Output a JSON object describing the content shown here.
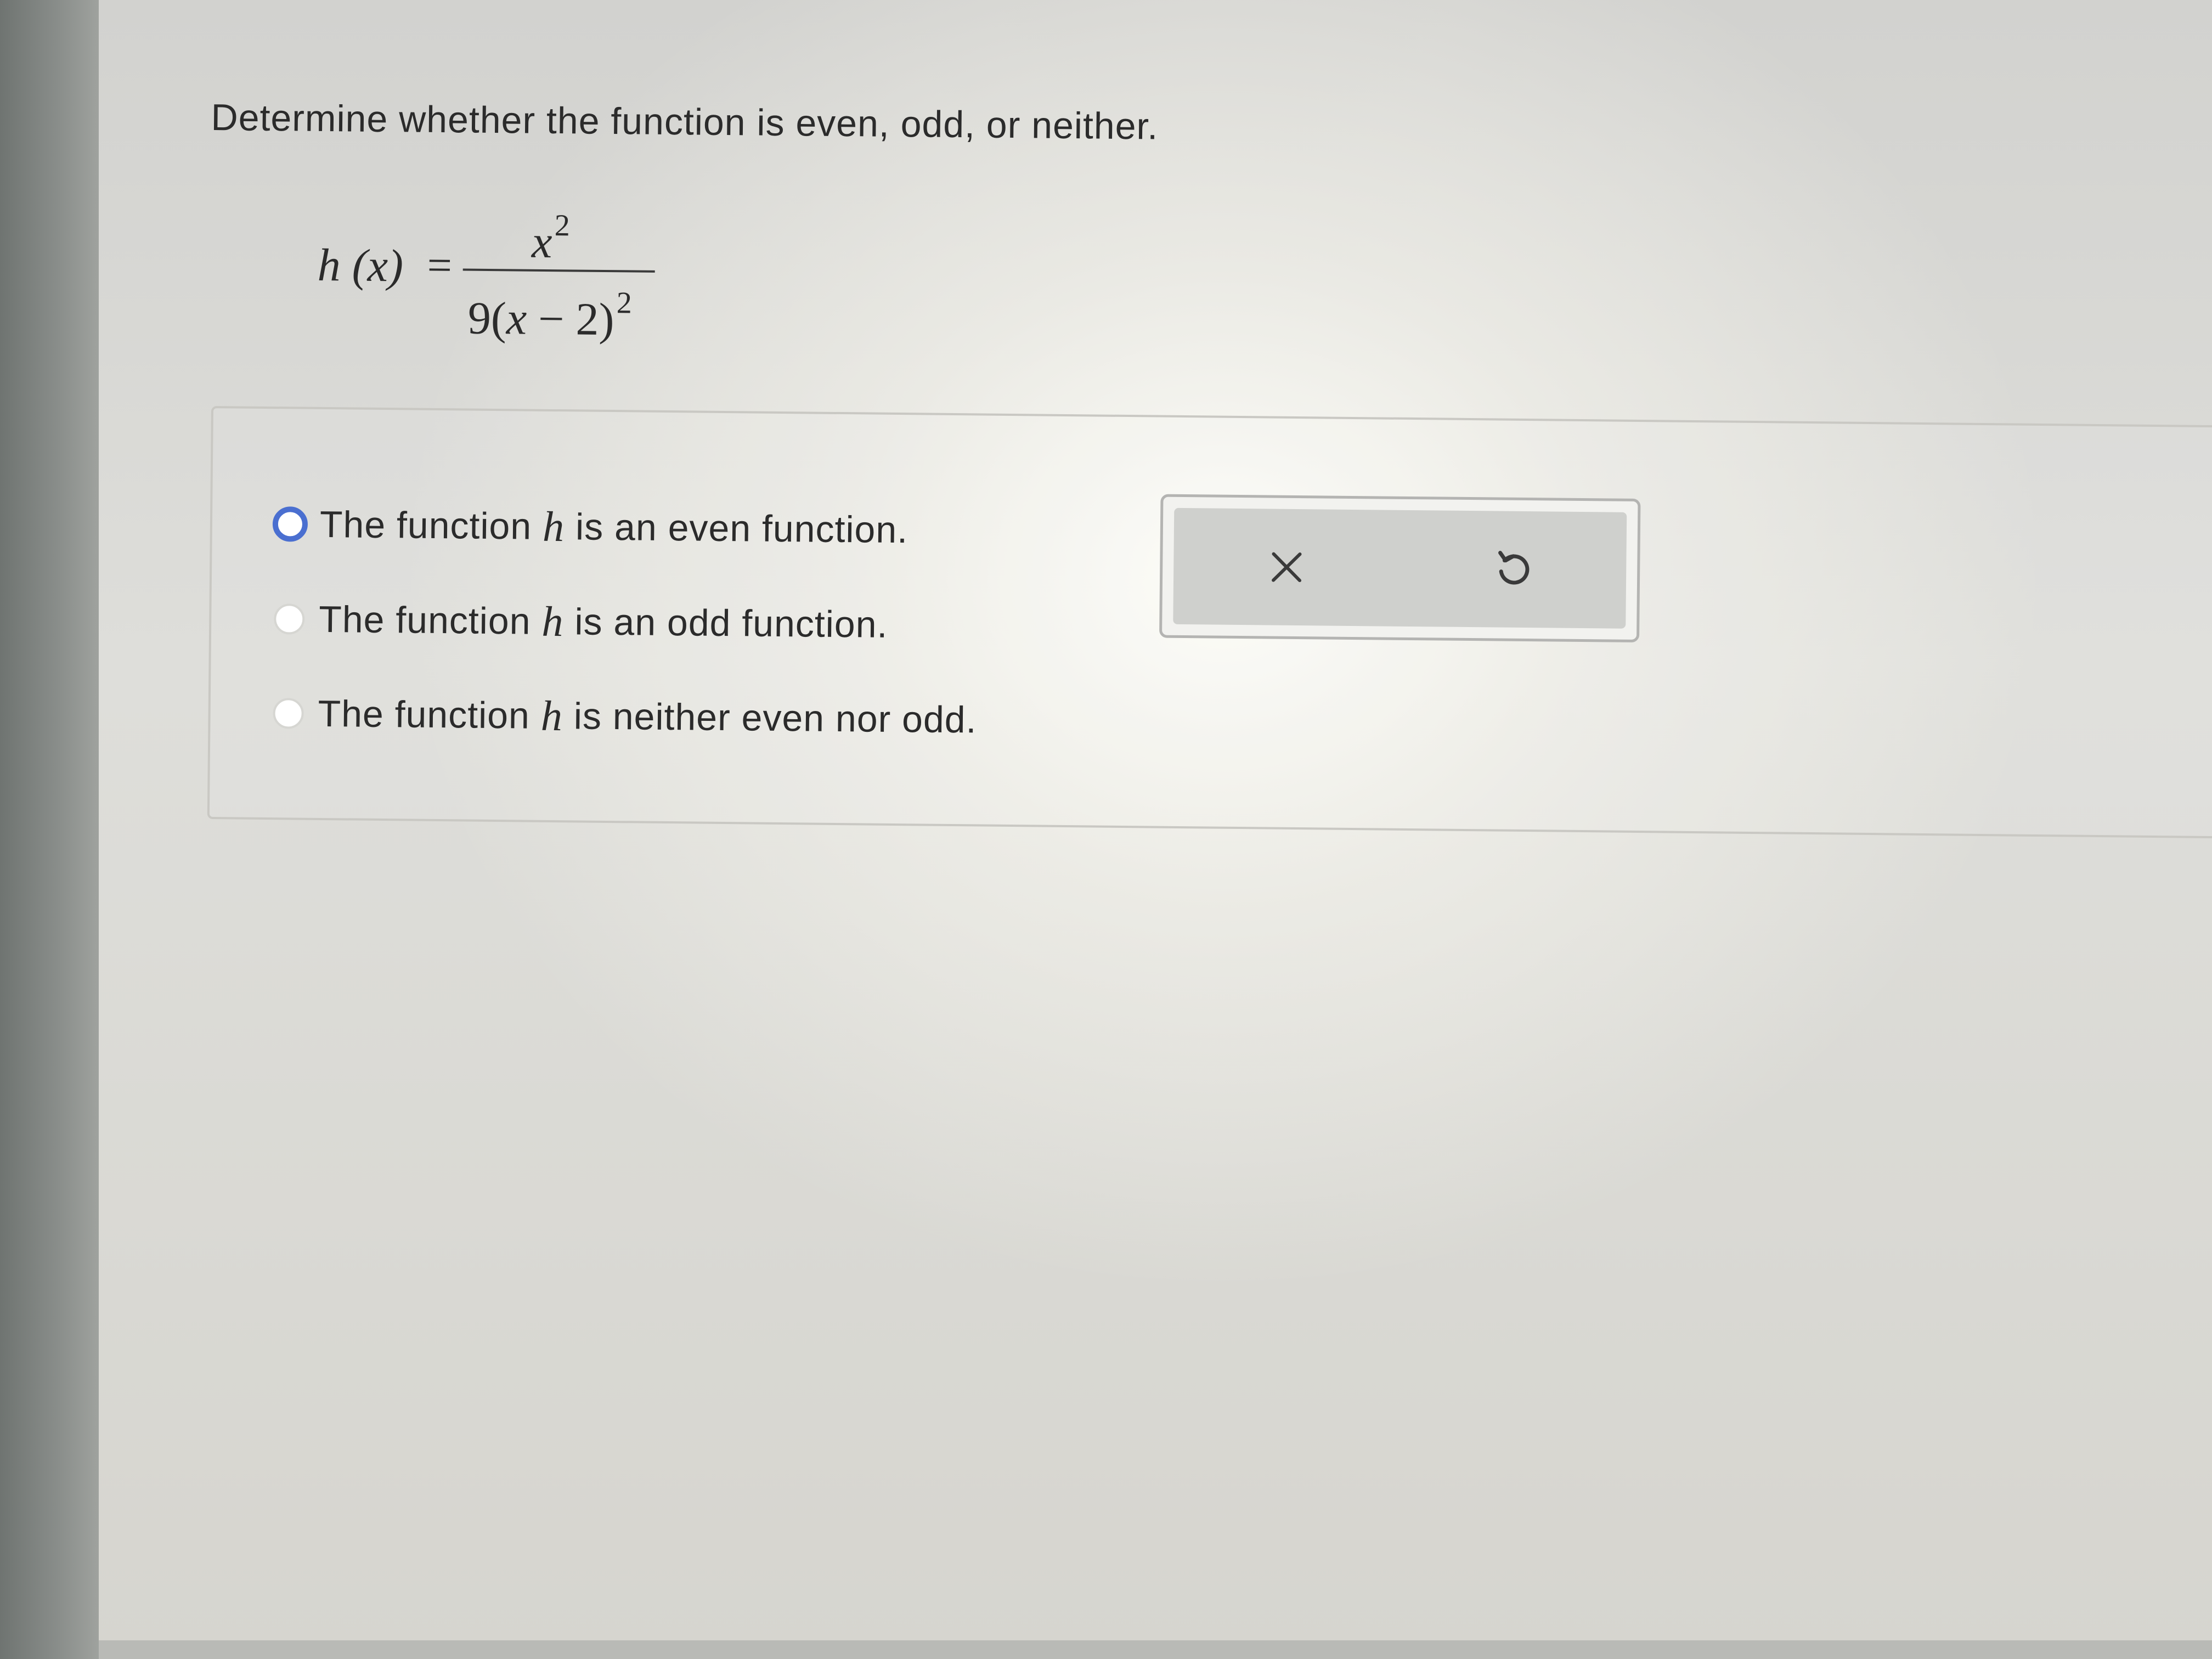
{
  "question": {
    "prompt": "Determine whether the function is even, odd, or neither."
  },
  "formula": {
    "lhs": "h (x)",
    "equals": "=",
    "numerator_base": "x",
    "numerator_exponent": "2",
    "denominator_coefficient": "9",
    "denominator_open": "(",
    "denominator_var": "x",
    "denominator_rest": " − 2)",
    "denominator_exponent": "2"
  },
  "options": [
    {
      "prefix": "The function",
      "var": "h",
      "suffix": "is an even function.",
      "state": "focused"
    },
    {
      "prefix": "The function",
      "var": "h",
      "suffix": "is an odd function.",
      "state": "unselected"
    },
    {
      "prefix": "The function",
      "var": "h",
      "suffix": "is neither even nor odd.",
      "state": "unselected"
    }
  ],
  "actions": {
    "clear_icon": "close-icon",
    "reset_icon": "undo-icon"
  },
  "colors": {
    "focus_ring": "#4a6fd0",
    "text": "#2b2b2b"
  }
}
